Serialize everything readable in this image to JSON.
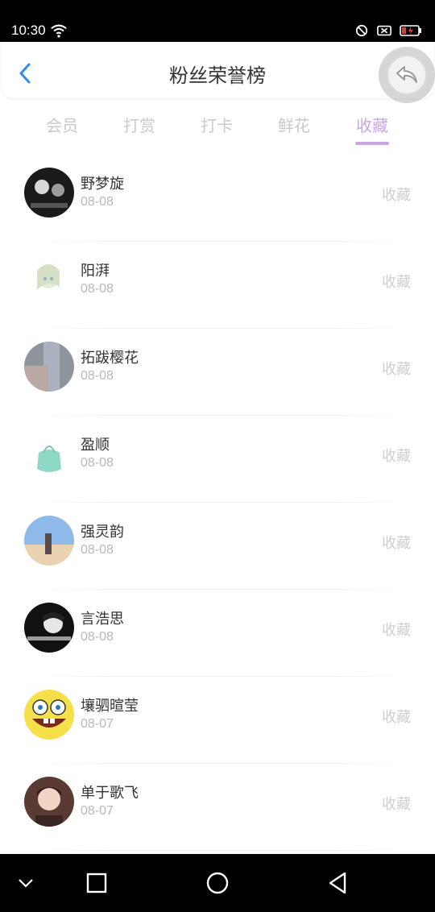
{
  "status_bar": {
    "time": "10:30"
  },
  "header": {
    "title": "粉丝荣誉榜"
  },
  "tabs": [
    {
      "label": "会员"
    },
    {
      "label": "打赏"
    },
    {
      "label": "打卡"
    },
    {
      "label": "鲜花"
    },
    {
      "label": "收藏",
      "active": true
    }
  ],
  "list": [
    {
      "name": "野梦旋",
      "date": "08-08",
      "action": "收藏"
    },
    {
      "name": "阳湃",
      "date": "08-08",
      "action": "收藏"
    },
    {
      "name": "拓跋樱花",
      "date": "08-08",
      "action": "收藏"
    },
    {
      "name": "盈顺",
      "date": "08-08",
      "action": "收藏"
    },
    {
      "name": "强灵韵",
      "date": "08-08",
      "action": "收藏"
    },
    {
      "name": "言浩思",
      "date": "08-08",
      "action": "收藏"
    },
    {
      "name": "壤驷暄莹",
      "date": "08-07",
      "action": "收藏"
    },
    {
      "name": "单于歌飞",
      "date": "08-07",
      "action": "收藏"
    }
  ],
  "colors": {
    "accent": "#c8a6e3",
    "back_arrow": "#2f8ef2",
    "muted": "#cfcfcf"
  }
}
